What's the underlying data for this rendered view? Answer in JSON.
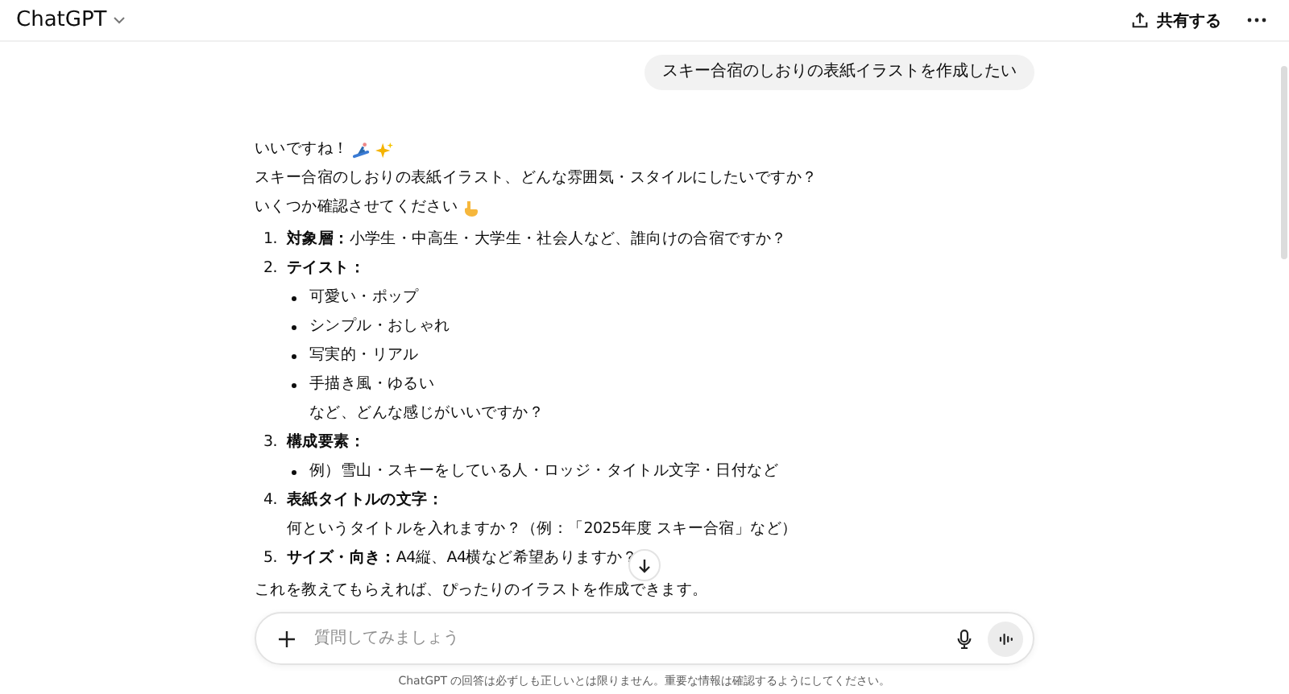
{
  "header": {
    "title": "ChatGPT",
    "share_label": "共有する"
  },
  "user_message": "スキー合宿のしおりの表紙イラストを作成したい",
  "assistant": {
    "intro": [
      "いいですね！",
      "スキー合宿のしおりの表紙イラスト、どんな雰囲気・スタイルにしたいですか？",
      "いくつか確認させてください"
    ],
    "items": [
      {
        "number": "1.",
        "label": "対象層：",
        "text": "小学生・中高生・大学生・社会人など、誰向けの合宿ですか？"
      },
      {
        "number": "2.",
        "label": "テイスト：",
        "bullets": [
          "可愛い・ポップ",
          "シンプル・おしゃれ",
          "写実的・リアル",
          "手描き風・ゆるい"
        ],
        "after": "など、どんな感じがいいですか？"
      },
      {
        "number": "3.",
        "label": "構成要素：",
        "bullets": [
          "例）雪山・スキーをしている人・ロッジ・タイトル文字・日付など"
        ]
      },
      {
        "number": "4.",
        "label": "表紙タイトルの文字：",
        "after": "何というタイトルを入れますか？（例：「2025年度 スキー合宿」など）"
      },
      {
        "number": "5.",
        "label": "サイズ・向き：",
        "text": "A4縦、A4横など希望ありますか？"
      }
    ],
    "outro": "これを教えてもらえれば、ぴったりのイラストを作成できます。"
  },
  "composer": {
    "placeholder": "質問してみましょう"
  },
  "disclaimer": "ChatGPT の回答は必ずしも正しいとは限りません。重要な情報は確認するようにしてください。"
}
